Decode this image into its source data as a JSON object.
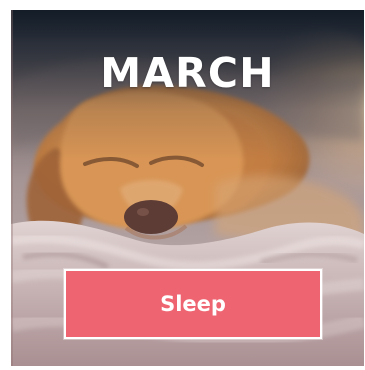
{
  "card": {
    "title": "MARCH",
    "button_label": "Sleep"
  },
  "colors": {
    "title_text": "#ffffff",
    "button_background": "#ee6571",
    "button_border": "#ffffff",
    "button_text": "#ffffff"
  }
}
